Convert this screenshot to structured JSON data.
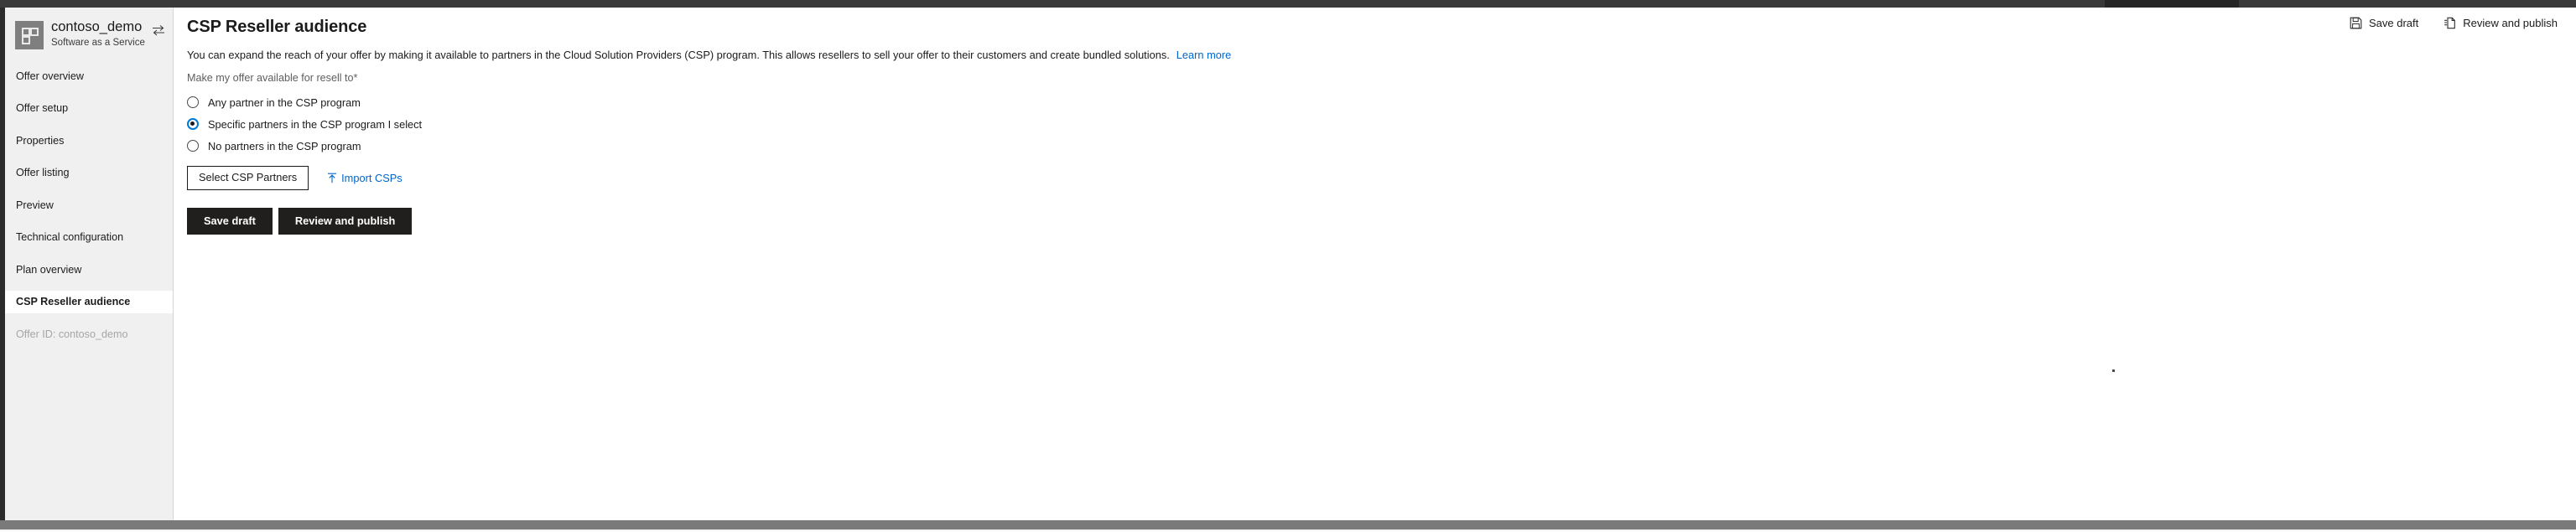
{
  "window": {
    "chrome_color": "#333333"
  },
  "sidebar": {
    "offer_name": "contoso_demo",
    "offer_kind": "Software as a Service",
    "switch_icon": "switch-offer-icon",
    "app_icon": "app-grid-icon",
    "items": [
      {
        "label": "Offer overview",
        "selected": false,
        "muted": false
      },
      {
        "label": "Offer setup",
        "selected": false,
        "muted": false
      },
      {
        "label": "Properties",
        "selected": false,
        "muted": false
      },
      {
        "label": "Offer listing",
        "selected": false,
        "muted": false
      },
      {
        "label": "Preview",
        "selected": false,
        "muted": false
      },
      {
        "label": "Technical configuration",
        "selected": false,
        "muted": false
      },
      {
        "label": "Plan overview",
        "selected": false,
        "muted": false
      },
      {
        "label": "CSP Reseller audience",
        "selected": true,
        "muted": false
      },
      {
        "label": "Offer ID: contoso_demo",
        "selected": false,
        "muted": true
      }
    ]
  },
  "main": {
    "title": "CSP Reseller audience",
    "top_actions": [
      {
        "label": "Save draft",
        "icon": "save-icon"
      },
      {
        "label": "Review and publish",
        "icon": "publish-document-icon"
      }
    ],
    "description": "You can expand the reach of your offer by making it available to partners in the Cloud Solution Providers (CSP) program. This allows resellers to sell your offer to their customers and create bundled solutions.",
    "description_link": "Learn more",
    "field_label": "Make my offer available for resell to*",
    "radio_options": [
      {
        "label": "Any partner in the CSP program",
        "checked": false
      },
      {
        "label": "Specific partners in the CSP program I select",
        "checked": true
      },
      {
        "label": "No partners in the CSP program",
        "checked": false
      }
    ],
    "select_partners_label": "Select CSP Partners",
    "import_csps_label": "Import CSPs",
    "import_icon": "upload-icon",
    "save_draft_label": "Save draft",
    "review_publish_label": "Review and publish"
  },
  "colors": {
    "accent": "#0078d4",
    "link": "#0066cc",
    "primary_button": "#201f1e",
    "sidebar_bg": "#f0f0f0"
  }
}
